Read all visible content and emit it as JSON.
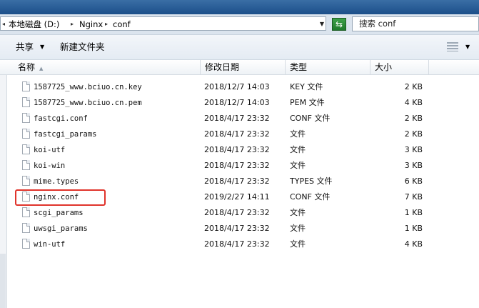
{
  "window": {
    "breadcrumb": [
      "本地磁盘 (D:)",
      "Nginx",
      "conf"
    ],
    "search_placeholder": "搜索 conf"
  },
  "toolbar": {
    "share_label": "共享",
    "new_folder_label": "新建文件夹"
  },
  "columns": {
    "name": "名称",
    "modified": "修改日期",
    "type": "类型",
    "size": "大小"
  },
  "files": [
    {
      "name": "1587725_www.bciuo.cn.key",
      "modified": "2018/12/7 14:03",
      "type": "KEY 文件",
      "size": "2 KB"
    },
    {
      "name": "1587725_www.bciuo.cn.pem",
      "modified": "2018/12/7 14:03",
      "type": "PEM 文件",
      "size": "4 KB"
    },
    {
      "name": "fastcgi.conf",
      "modified": "2018/4/17 23:32",
      "type": "CONF 文件",
      "size": "2 KB"
    },
    {
      "name": "fastcgi_params",
      "modified": "2018/4/17 23:32",
      "type": "文件",
      "size": "2 KB"
    },
    {
      "name": "koi-utf",
      "modified": "2018/4/17 23:32",
      "type": "文件",
      "size": "3 KB"
    },
    {
      "name": "koi-win",
      "modified": "2018/4/17 23:32",
      "type": "文件",
      "size": "3 KB"
    },
    {
      "name": "mime.types",
      "modified": "2018/4/17 23:32",
      "type": "TYPES 文件",
      "size": "6 KB"
    },
    {
      "name": "nginx.conf",
      "modified": "2019/2/27 14:11",
      "type": "CONF 文件",
      "size": "7 KB"
    },
    {
      "name": "scgi_params",
      "modified": "2018/4/17 23:32",
      "type": "文件",
      "size": "1 KB"
    },
    {
      "name": "uwsgi_params",
      "modified": "2018/4/17 23:32",
      "type": "文件",
      "size": "1 KB"
    },
    {
      "name": "win-utf",
      "modified": "2018/4/17 23:32",
      "type": "文件",
      "size": "4 KB"
    }
  ],
  "colors": {
    "highlight": "#e0332b",
    "title_bar": "#1c4f8a",
    "refresh": "#2b8a36"
  }
}
